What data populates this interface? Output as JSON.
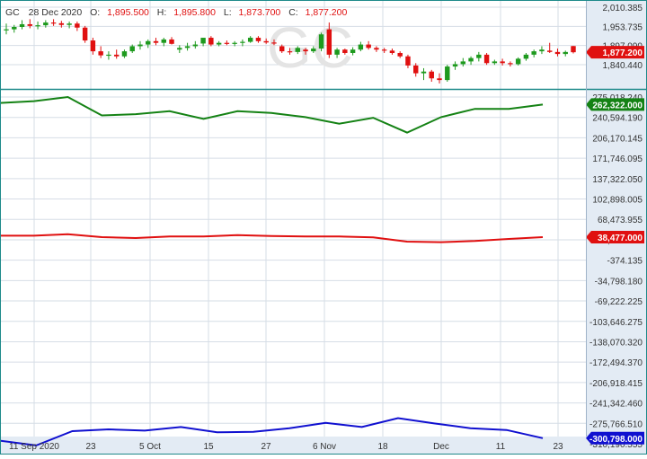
{
  "header": {
    "symbol": "GC",
    "date": "28 Dec 2020",
    "open_label": "O:",
    "open": "1,895.500",
    "high_label": "H:",
    "high": "1,895.800",
    "low_label": "L:",
    "low": "1,873.700",
    "close_label": "C:",
    "close": "1,877.200"
  },
  "watermark": "GC",
  "colors": {
    "up": "#1e9a1e",
    "down": "#e01010",
    "grid": "#d6dde6",
    "axis_bg": "#e3ebf4",
    "border": "#1e8a8a",
    "text": "#333333",
    "ohlc_value": "#e01010",
    "green_series": "#148214",
    "red_series": "#e01010",
    "blue_series": "#1010d0"
  },
  "chart_data": {
    "type": "line",
    "x_labels": [
      "11 Sep 2020",
      "23",
      "5 Oct",
      "15",
      "27",
      "6 Nov",
      "18",
      "Dec",
      "11",
      "23"
    ],
    "price_panel": {
      "type": "candlestick",
      "y_ticks": [
        "2,010.385",
        "1,953.735",
        "1,897.090",
        "1,840.440"
      ],
      "last_value_label": "1,877.200",
      "candles": [
        {
          "o": 1943,
          "h": 1962,
          "l": 1930,
          "c": 1945
        },
        {
          "o": 1945,
          "h": 1958,
          "l": 1935,
          "c": 1952
        },
        {
          "o": 1952,
          "h": 1972,
          "l": 1945,
          "c": 1960
        },
        {
          "o": 1960,
          "h": 1975,
          "l": 1948,
          "c": 1955
        },
        {
          "o": 1955,
          "h": 1968,
          "l": 1945,
          "c": 1957
        },
        {
          "o": 1957,
          "h": 1972,
          "l": 1950,
          "c": 1965
        },
        {
          "o": 1965,
          "h": 1975,
          "l": 1955,
          "c": 1963
        },
        {
          "o": 1963,
          "h": 1970,
          "l": 1950,
          "c": 1958
        },
        {
          "o": 1958,
          "h": 1968,
          "l": 1948,
          "c": 1962
        },
        {
          "o": 1962,
          "h": 1968,
          "l": 1940,
          "c": 1950
        },
        {
          "o": 1950,
          "h": 1955,
          "l": 1905,
          "c": 1912
        },
        {
          "o": 1912,
          "h": 1920,
          "l": 1870,
          "c": 1880
        },
        {
          "o": 1880,
          "h": 1895,
          "l": 1860,
          "c": 1868
        },
        {
          "o": 1868,
          "h": 1880,
          "l": 1855,
          "c": 1870
        },
        {
          "o": 1870,
          "h": 1885,
          "l": 1858,
          "c": 1865
        },
        {
          "o": 1865,
          "h": 1885,
          "l": 1860,
          "c": 1880
        },
        {
          "o": 1880,
          "h": 1900,
          "l": 1875,
          "c": 1895
        },
        {
          "o": 1895,
          "h": 1910,
          "l": 1885,
          "c": 1900
        },
        {
          "o": 1900,
          "h": 1915,
          "l": 1890,
          "c": 1910
        },
        {
          "o": 1910,
          "h": 1920,
          "l": 1898,
          "c": 1905
        },
        {
          "o": 1905,
          "h": 1920,
          "l": 1895,
          "c": 1915
        },
        {
          "o": 1915,
          "h": 1922,
          "l": 1900,
          "c": 1902
        },
        {
          "o": 1885,
          "h": 1898,
          "l": 1875,
          "c": 1890
        },
        {
          "o": 1890,
          "h": 1905,
          "l": 1882,
          "c": 1895
        },
        {
          "o": 1895,
          "h": 1910,
          "l": 1888,
          "c": 1900
        },
        {
          "o": 1903,
          "h": 1915,
          "l": 1895,
          "c": 1920
        },
        {
          "o": 1920,
          "h": 1925,
          "l": 1895,
          "c": 1900
        },
        {
          "o": 1900,
          "h": 1910,
          "l": 1895,
          "c": 1905
        },
        {
          "o": 1905,
          "h": 1912,
          "l": 1898,
          "c": 1902
        },
        {
          "o": 1902,
          "h": 1910,
          "l": 1895,
          "c": 1905
        },
        {
          "o": 1905,
          "h": 1915,
          "l": 1895,
          "c": 1908
        },
        {
          "o": 1908,
          "h": 1925,
          "l": 1905,
          "c": 1920
        },
        {
          "o": 1920,
          "h": 1925,
          "l": 1905,
          "c": 1910
        },
        {
          "o": 1910,
          "h": 1918,
          "l": 1902,
          "c": 1906
        },
        {
          "o": 1906,
          "h": 1915,
          "l": 1898,
          "c": 1904
        },
        {
          "o": 1895,
          "h": 1900,
          "l": 1875,
          "c": 1880
        },
        {
          "o": 1880,
          "h": 1890,
          "l": 1870,
          "c": 1878
        },
        {
          "o": 1878,
          "h": 1895,
          "l": 1872,
          "c": 1890
        },
        {
          "o": 1885,
          "h": 1890,
          "l": 1870,
          "c": 1880
        },
        {
          "o": 1880,
          "h": 1895,
          "l": 1875,
          "c": 1888
        },
        {
          "o": 1888,
          "h": 1935,
          "l": 1880,
          "c": 1930
        },
        {
          "o": 1945,
          "h": 1965,
          "l": 1860,
          "c": 1870
        },
        {
          "o": 1870,
          "h": 1890,
          "l": 1860,
          "c": 1885
        },
        {
          "o": 1885,
          "h": 1888,
          "l": 1870,
          "c": 1875
        },
        {
          "o": 1875,
          "h": 1892,
          "l": 1868,
          "c": 1885
        },
        {
          "o": 1885,
          "h": 1908,
          "l": 1880,
          "c": 1900
        },
        {
          "o": 1900,
          "h": 1910,
          "l": 1885,
          "c": 1890
        },
        {
          "o": 1890,
          "h": 1895,
          "l": 1878,
          "c": 1885
        },
        {
          "o": 1885,
          "h": 1890,
          "l": 1875,
          "c": 1882
        },
        {
          "o": 1882,
          "h": 1888,
          "l": 1870,
          "c": 1875
        },
        {
          "o": 1875,
          "h": 1880,
          "l": 1860,
          "c": 1865
        },
        {
          "o": 1865,
          "h": 1870,
          "l": 1830,
          "c": 1838
        },
        {
          "o": 1838,
          "h": 1845,
          "l": 1805,
          "c": 1815
        },
        {
          "o": 1815,
          "h": 1830,
          "l": 1795,
          "c": 1820
        },
        {
          "o": 1820,
          "h": 1825,
          "l": 1790,
          "c": 1800
        },
        {
          "o": 1800,
          "h": 1815,
          "l": 1785,
          "c": 1795
        },
        {
          "o": 1795,
          "h": 1840,
          "l": 1790,
          "c": 1835
        },
        {
          "o": 1835,
          "h": 1850,
          "l": 1825,
          "c": 1842
        },
        {
          "o": 1842,
          "h": 1860,
          "l": 1835,
          "c": 1850
        },
        {
          "o": 1850,
          "h": 1865,
          "l": 1840,
          "c": 1860
        },
        {
          "o": 1860,
          "h": 1878,
          "l": 1850,
          "c": 1870
        },
        {
          "o": 1870,
          "h": 1875,
          "l": 1840,
          "c": 1845
        },
        {
          "o": 1845,
          "h": 1855,
          "l": 1840,
          "c": 1850
        },
        {
          "o": 1850,
          "h": 1858,
          "l": 1838,
          "c": 1845
        },
        {
          "o": 1845,
          "h": 1850,
          "l": 1835,
          "c": 1842
        },
        {
          "o": 1842,
          "h": 1862,
          "l": 1838,
          "c": 1858
        },
        {
          "o": 1858,
          "h": 1875,
          "l": 1852,
          "c": 1870
        },
        {
          "o": 1870,
          "h": 1885,
          "l": 1862,
          "c": 1880
        },
        {
          "o": 1880,
          "h": 1895,
          "l": 1872,
          "c": 1885
        },
        {
          "o": 1882,
          "h": 1905,
          "l": 1875,
          "c": 1878
        },
        {
          "o": 1878,
          "h": 1888,
          "l": 1865,
          "c": 1872
        },
        {
          "o": 1872,
          "h": 1882,
          "l": 1865,
          "c": 1878
        },
        {
          "o": 1895.5,
          "h": 1895.8,
          "l": 1873.7,
          "c": 1877.2
        }
      ]
    },
    "indicator_panel": {
      "y_ticks": [
        "275,018.240",
        "240,594.190",
        "206,170.145",
        "171,746.095",
        "137,322.050",
        "102,898.005",
        "68,473.955",
        "34,049.905",
        "-374.135",
        "-34,798.180",
        "-69,222.225",
        "-103,646.275",
        "-138,070.320",
        "-172,494.370",
        "-206,918.415",
        "-241,342.460",
        "-275,766.510",
        "-310,190.555"
      ],
      "series": [
        {
          "color": "green",
          "last_value_label": "262,322.000",
          "values": [
            265000,
            268000,
            275000,
            244000,
            246000,
            251000,
            238000,
            251000,
            248000,
            241000,
            230000,
            240000,
            215000,
            241000,
            255000,
            255000,
            262322
          ]
        },
        {
          "color": "red",
          "last_value_label": "38,477.000",
          "values": [
            41000,
            41000,
            43500,
            38500,
            37000,
            39500,
            39500,
            42000,
            40500,
            39500,
            39500,
            38000,
            31000,
            30000,
            32000,
            35500,
            38477
          ]
        },
        {
          "color": "blue",
          "last_value_label": "-300,798.000",
          "values": [
            -305000,
            -313000,
            -289000,
            -286000,
            -288000,
            -282000,
            -291000,
            -290000,
            -284000,
            -275000,
            -282000,
            -267000,
            -276000,
            -284000,
            -287000,
            -300798
          ]
        }
      ]
    }
  }
}
